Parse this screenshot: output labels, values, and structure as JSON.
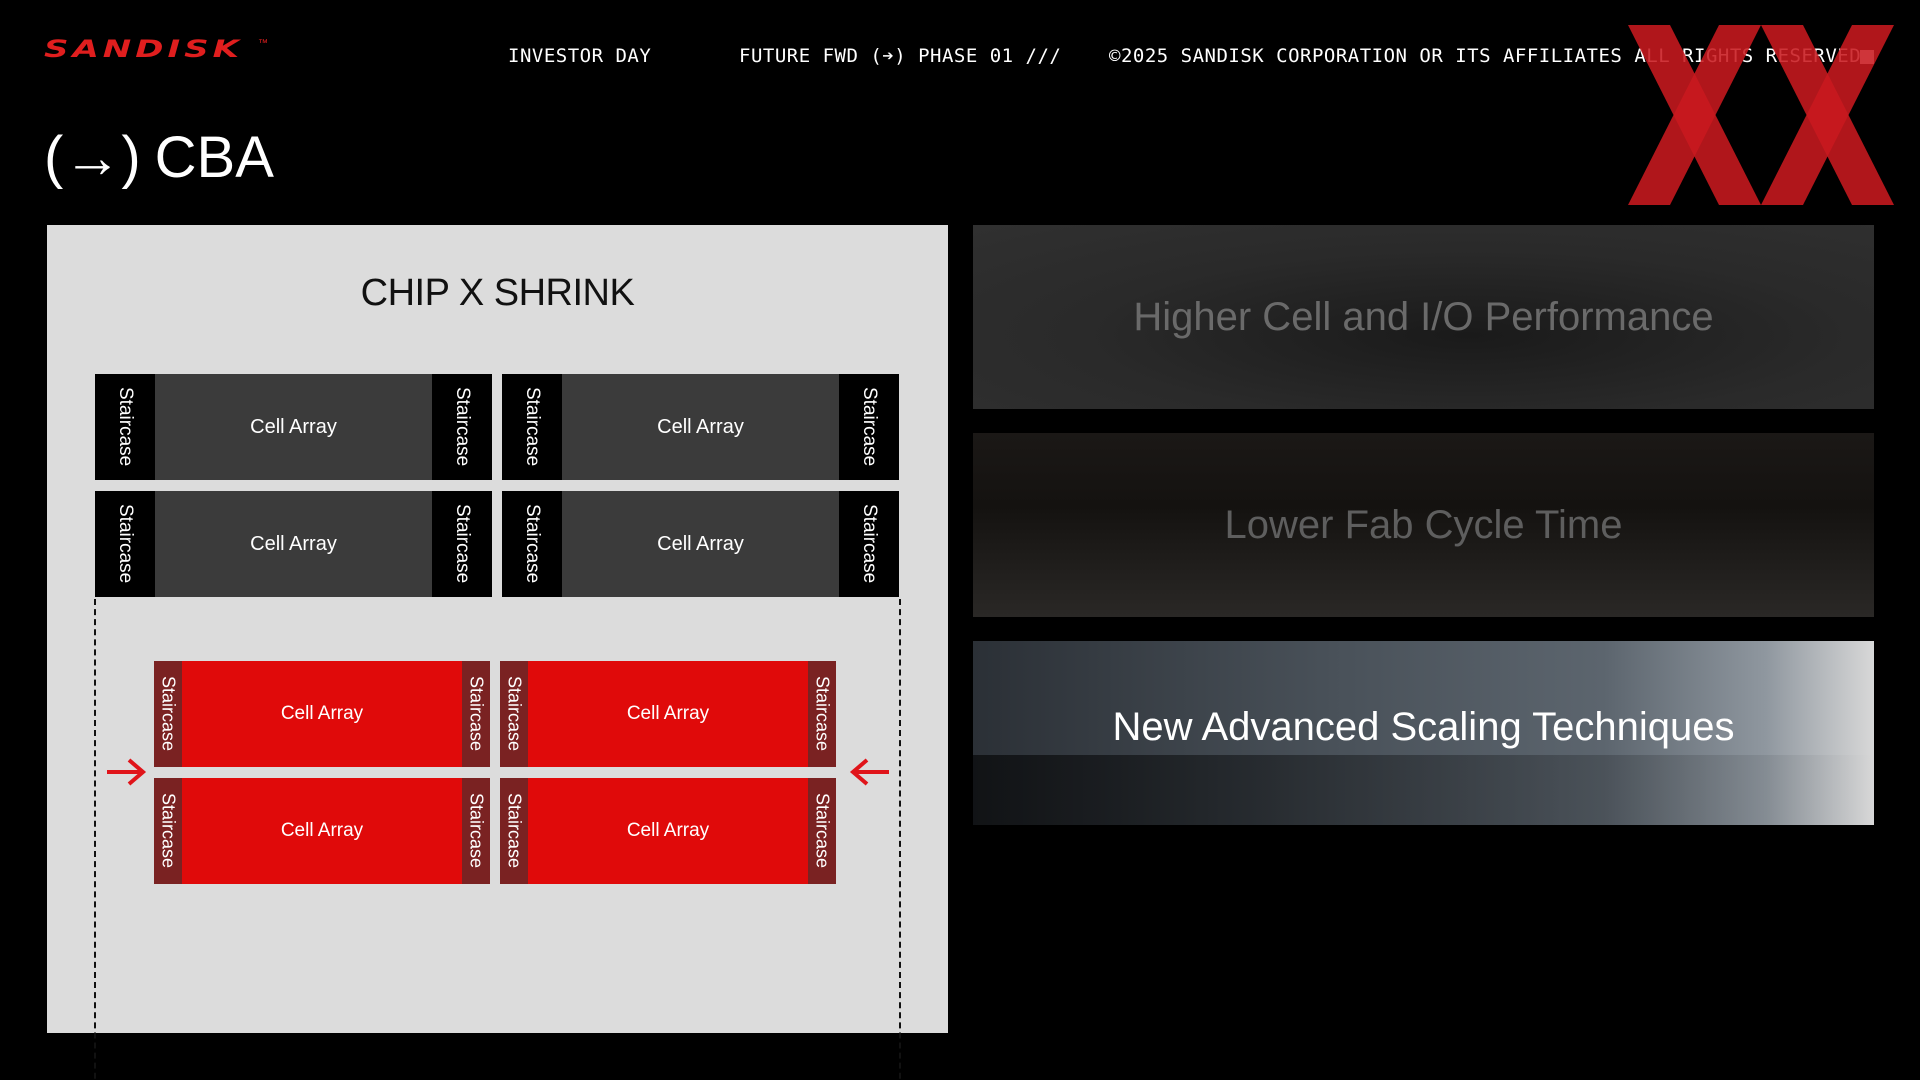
{
  "header": {
    "logo": "SANDISK",
    "logo_tm": "™",
    "investor_day": "INVESTOR DAY",
    "future_fwd": "FUTURE FWD (➔) PHASE 01 ///",
    "copyright": "©2025 SANDISK CORPORATION OR ITS AFFILIATES ALL RIGHTS RESERVED"
  },
  "colors": {
    "brand_red": "#e01e1e",
    "shrunk_cell_red": "#e00a0a",
    "staircase_dark_red": "#7a2222",
    "panel_bg": "#dcdcdc"
  },
  "title": {
    "arrow": "(→)",
    "text": "CBA"
  },
  "diagram": {
    "title": "CHIP X SHRINK",
    "staircase_label": "Staircase",
    "cell_array_label": "Cell Array",
    "original_blocks": [
      {
        "staircase_left": "Staircase",
        "cell": "Cell Array",
        "staircase_right": "Staircase"
      },
      {
        "staircase_left": "Staircase",
        "cell": "Cell Array",
        "staircase_right": "Staircase"
      },
      {
        "staircase_left": "Staircase",
        "cell": "Cell Array",
        "staircase_right": "Staircase"
      },
      {
        "staircase_left": "Staircase",
        "cell": "Cell Array",
        "staircase_right": "Staircase"
      }
    ],
    "shrunk_blocks": [
      {
        "staircase_left": "Staircase",
        "cell": "Cell Array",
        "staircase_right": "Staircase"
      },
      {
        "staircase_left": "Staircase",
        "cell": "Cell Array",
        "staircase_right": "Staircase"
      },
      {
        "staircase_left": "Staircase",
        "cell": "Cell Array",
        "staircase_right": "Staircase"
      },
      {
        "staircase_left": "Staircase",
        "cell": "Cell Array",
        "staircase_right": "Staircase"
      }
    ]
  },
  "features": [
    {
      "label": "Higher Cell and I/O Performance",
      "active": false
    },
    {
      "label": "Lower Fab Cycle Time",
      "active": false
    },
    {
      "label": "New Advanced Scaling Techniques",
      "active": true
    }
  ]
}
